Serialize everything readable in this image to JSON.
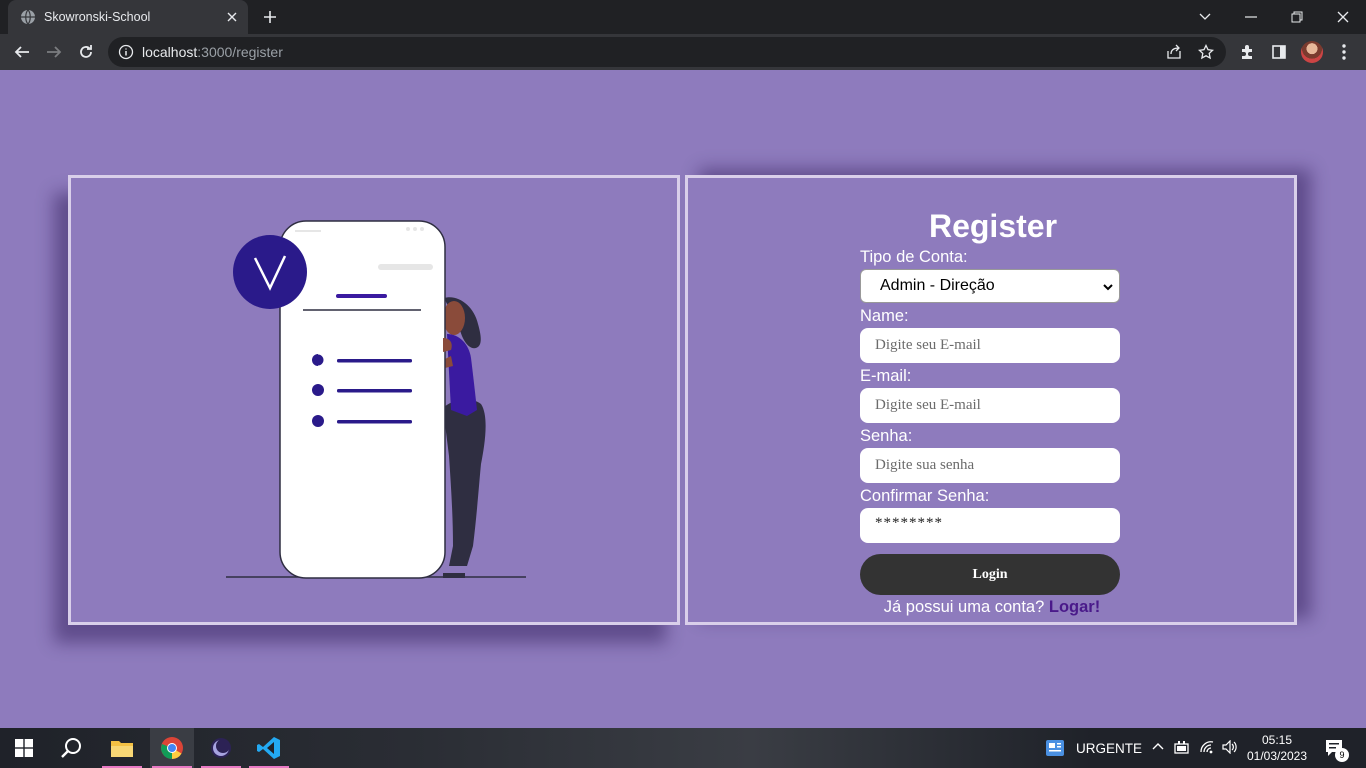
{
  "browser": {
    "tab_title": "Skowronski-School",
    "url_host": "localhost",
    "url_rest": ":3000/register"
  },
  "form": {
    "title": "Register",
    "account_type_label": "Tipo de Conta:",
    "account_type_value": "Admin - Direção",
    "name_label": "Name:",
    "name_placeholder": "Digite seu E-mail",
    "email_label": "E-mail:",
    "email_placeholder": "Digite seu E-mail",
    "password_label": "Senha:",
    "password_placeholder": "Digite sua senha",
    "confirm_label": "Confirmar Senha:",
    "confirm_value": "********",
    "submit_label": "Login",
    "footer_text": "Já possui uma conta?",
    "footer_link": "Logar!"
  },
  "taskbar": {
    "widget_text": "URGENTE",
    "time": "05:15",
    "date": "01/03/2023",
    "notification_count": "9"
  },
  "colors": {
    "page_bg": "#8e7bbd",
    "accent": "#2a1a8a",
    "button": "#333333",
    "link": "#4a1a8a"
  },
  "icons": [
    "globe-icon",
    "close-icon",
    "plus-icon",
    "back-icon",
    "forward-icon",
    "reload-icon",
    "info-icon",
    "share-icon",
    "star-icon",
    "extensions-icon",
    "sidepanel-icon",
    "menu-icon",
    "windows-icon",
    "search-icon",
    "folder-icon",
    "chrome-icon",
    "eclipse-icon",
    "vscode-icon"
  ]
}
